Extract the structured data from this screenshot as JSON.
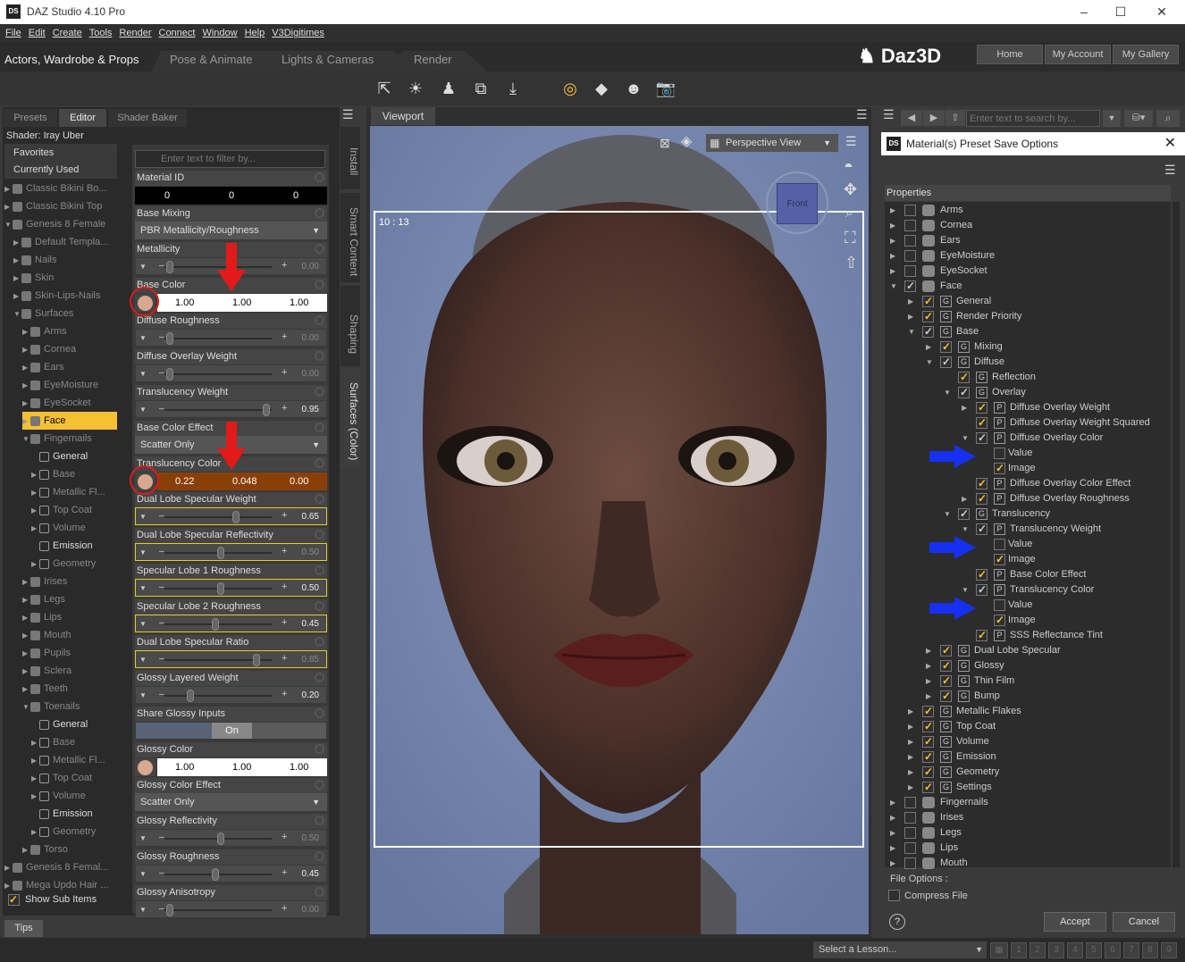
{
  "window": {
    "title": "DAZ Studio 4.10 Pro",
    "logo_text": "DS"
  },
  "menu": [
    "File",
    "Edit",
    "Create",
    "Tools",
    "Render",
    "Connect",
    "Window",
    "Help",
    "V3Digitimes"
  ],
  "main_tabs": [
    "Actors, Wardrobe & Props",
    "Pose & Animate",
    "Lights & Cameras",
    "Render"
  ],
  "brand": "Daz3D",
  "header_buttons": [
    "Home",
    "My Account",
    "My Gallery"
  ],
  "left_tabs": [
    "Presets",
    "Editor",
    "Shader Baker"
  ],
  "shader_label": "Shader: Iray Uber",
  "scene_tree": [
    "Favorites",
    "Currently Used",
    "Classic Bikini Bo...",
    "Classic Bikini Top",
    "Genesis 8 Female",
    "Default Templa...",
    "Nails",
    "Skin",
    "Skin-Lips-Nails",
    "Surfaces",
    "Arms",
    "Cornea",
    "Ears",
    "EyeMoisture",
    "EyeSocket",
    "Face",
    "Fingernails",
    "General",
    "Base",
    "Metallic Fl...",
    "Top Coat",
    "Volume",
    "Emission",
    "Geometry",
    "Irises",
    "Legs",
    "Lips",
    "Mouth",
    "Pupils",
    "Sclera",
    "Teeth",
    "Toenails",
    "General",
    "Base",
    "Metallic Fl...",
    "Top Coat",
    "Volume",
    "Emission",
    "Geometry",
    "Torso",
    "Genesis 8 Femal...",
    "Mega Updo Hair ..."
  ],
  "show_sub_items": "Show Sub Items",
  "filter_placeholder": "Enter text to filter by...",
  "properties": {
    "material_id": {
      "label": "Material ID",
      "values": [
        "0",
        "0",
        "0"
      ]
    },
    "base_mixing": {
      "label": "Base Mixing",
      "value": "PBR Metallicity/Roughness"
    },
    "metallicity": {
      "label": "Metallicity",
      "value": "0.00",
      "level": 0.0
    },
    "base_color": {
      "label": "Base Color",
      "values": [
        "1.00",
        "1.00",
        "1.00"
      ],
      "color": "#ffffff"
    },
    "diffuse_roughness": {
      "label": "Diffuse Roughness",
      "value": "0.00",
      "level": 0.0
    },
    "diffuse_overlay_weight": {
      "label": "Diffuse Overlay Weight",
      "value": "0.00",
      "level": 0.0
    },
    "translucency_weight": {
      "label": "Translucency Weight",
      "value": "0.95",
      "level": 0.95
    },
    "base_color_effect": {
      "label": "Base Color Effect",
      "value": "Scatter Only"
    },
    "translucency_color": {
      "label": "Translucency Color",
      "values": [
        "0.22",
        "0.048",
        "0.00"
      ],
      "color": "#8b3f08"
    },
    "dual_lobe_specular_weight": {
      "label": "Dual Lobe Specular Weight",
      "value": "0.65",
      "level": 0.65
    },
    "dual_lobe_specular_reflectivity": {
      "label": "Dual Lobe Specular Reflectivity",
      "value": "0.50",
      "level": 0.5
    },
    "specular_lobe_1_roughness": {
      "label": "Specular Lobe 1 Roughness",
      "value": "0.50",
      "level": 0.5
    },
    "specular_lobe_2_roughness": {
      "label": "Specular Lobe 2 Roughness",
      "value": "0.45",
      "level": 0.45
    },
    "dual_lobe_specular_ratio": {
      "label": "Dual Lobe Specular Ratio",
      "value": "0.85",
      "level": 0.85
    },
    "glossy_layered_weight": {
      "label": "Glossy Layered Weight",
      "value": "0.20",
      "level": 0.2
    },
    "share_glossy_inputs": {
      "label": "Share Glossy Inputs",
      "value": "On"
    },
    "glossy_color": {
      "label": "Glossy Color",
      "values": [
        "1.00",
        "1.00",
        "1.00"
      ]
    },
    "glossy_color_effect": {
      "label": "Glossy Color Effect",
      "value": "Scatter Only"
    },
    "glossy_reflectivity": {
      "label": "Glossy Reflectivity",
      "value": "0.50",
      "level": 0.5
    },
    "glossy_roughness": {
      "label": "Glossy Roughness",
      "value": "0.45",
      "level": 0.45
    },
    "glossy_anisotropy": {
      "label": "Glossy Anisotropy",
      "value": "0.00",
      "level": 0.0
    }
  },
  "side_tabs": [
    "Install",
    "Smart Content",
    "Shaping",
    "Surfaces (Color)"
  ],
  "viewport": {
    "tab": "Viewport",
    "view": "Perspective View",
    "timecode": "10 : 13",
    "cube_label": "Front"
  },
  "search_placeholder": "Enter text to search by...",
  "dialog": {
    "title": "Material(s) Preset Save Options",
    "properties_header": "Properties",
    "tree": [
      "Arms",
      "Cornea",
      "Ears",
      "EyeMoisture",
      "EyeSocket",
      "Face",
      "General",
      "Render Priority",
      "Base",
      "Mixing",
      "Diffuse",
      "Reflection",
      "Overlay",
      "Diffuse Overlay Weight",
      "Diffuse Overlay Weight Squared",
      "Diffuse Overlay Color",
      "Value",
      "Image",
      "Diffuse Overlay Color Effect",
      "Diffuse Overlay Roughness",
      "Translucency",
      "Translucency Weight",
      "Value",
      "Image",
      "Base Color Effect",
      "Translucency Color",
      "Value",
      "Image",
      "SSS Reflectance Tint",
      "Dual Lobe Specular",
      "Glossy",
      "Thin Film",
      "Bump",
      "Metallic Flakes",
      "Top Coat",
      "Volume",
      "Emission",
      "Geometry",
      "Settings",
      "Fingernails",
      "Irises",
      "Legs",
      "Lips",
      "Mouth"
    ],
    "file_options": "File Options :",
    "compress_file": "Compress File",
    "accept": "Accept",
    "cancel": "Cancel",
    "help": "?"
  },
  "bottom": {
    "tips": "Tips",
    "lesson": "Select a Lesson...",
    "pages": [
      "1",
      "2",
      "3",
      "4",
      "5",
      "6",
      "7",
      "8",
      "9"
    ]
  },
  "colors": {
    "selection": "#f5c033",
    "annotation_red": "#e21a1a",
    "annotation_blue": "#1530f0"
  }
}
